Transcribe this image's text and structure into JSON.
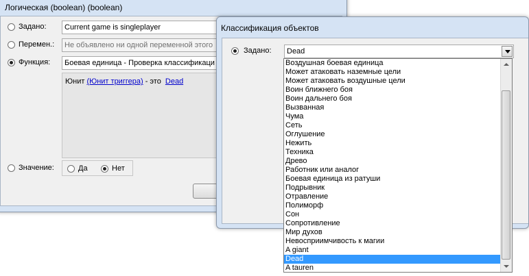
{
  "bool_dialog": {
    "title": "Логическая (boolean) (boolean)",
    "set_label": "Задано:",
    "set_value": "Current game is singleplayer",
    "var_label": "Перемен.:",
    "var_value": "Не объявлено ни одной переменной этого",
    "func_label": "Функция:",
    "func_value": "Боевая единица - Проверка классификаци",
    "desc_prefix": "Юнит",
    "desc_link1": "(Юнит триггера)",
    "desc_middle": "- это",
    "desc_link2": "Dead",
    "value_label": "Значение:",
    "yes_label": "Да",
    "no_label": "Нет"
  },
  "class_dialog": {
    "title": "Классификация объектов",
    "set_label": "Задано:",
    "selected_value": "Dead",
    "options": [
      "Воздушная боевая единица",
      "Может атаковать наземные цели",
      "Может атаковать воздушные цели",
      "Воин ближнего боя",
      "Воин дальнего боя",
      "Вызванная",
      "Чума",
      "Сеть",
      "Оглушение",
      "Нежить",
      "Техника",
      "Древо",
      "Работник или аналог",
      "Боевая единица из ратуши",
      "Подрывник",
      "Отравление",
      "Полиморф",
      "Сон",
      "Сопротивление",
      "Мир духов",
      "Невосприимчивость к магии",
      "A giant",
      "Dead",
      "A tauren"
    ],
    "highlighted_option": "Dead"
  }
}
